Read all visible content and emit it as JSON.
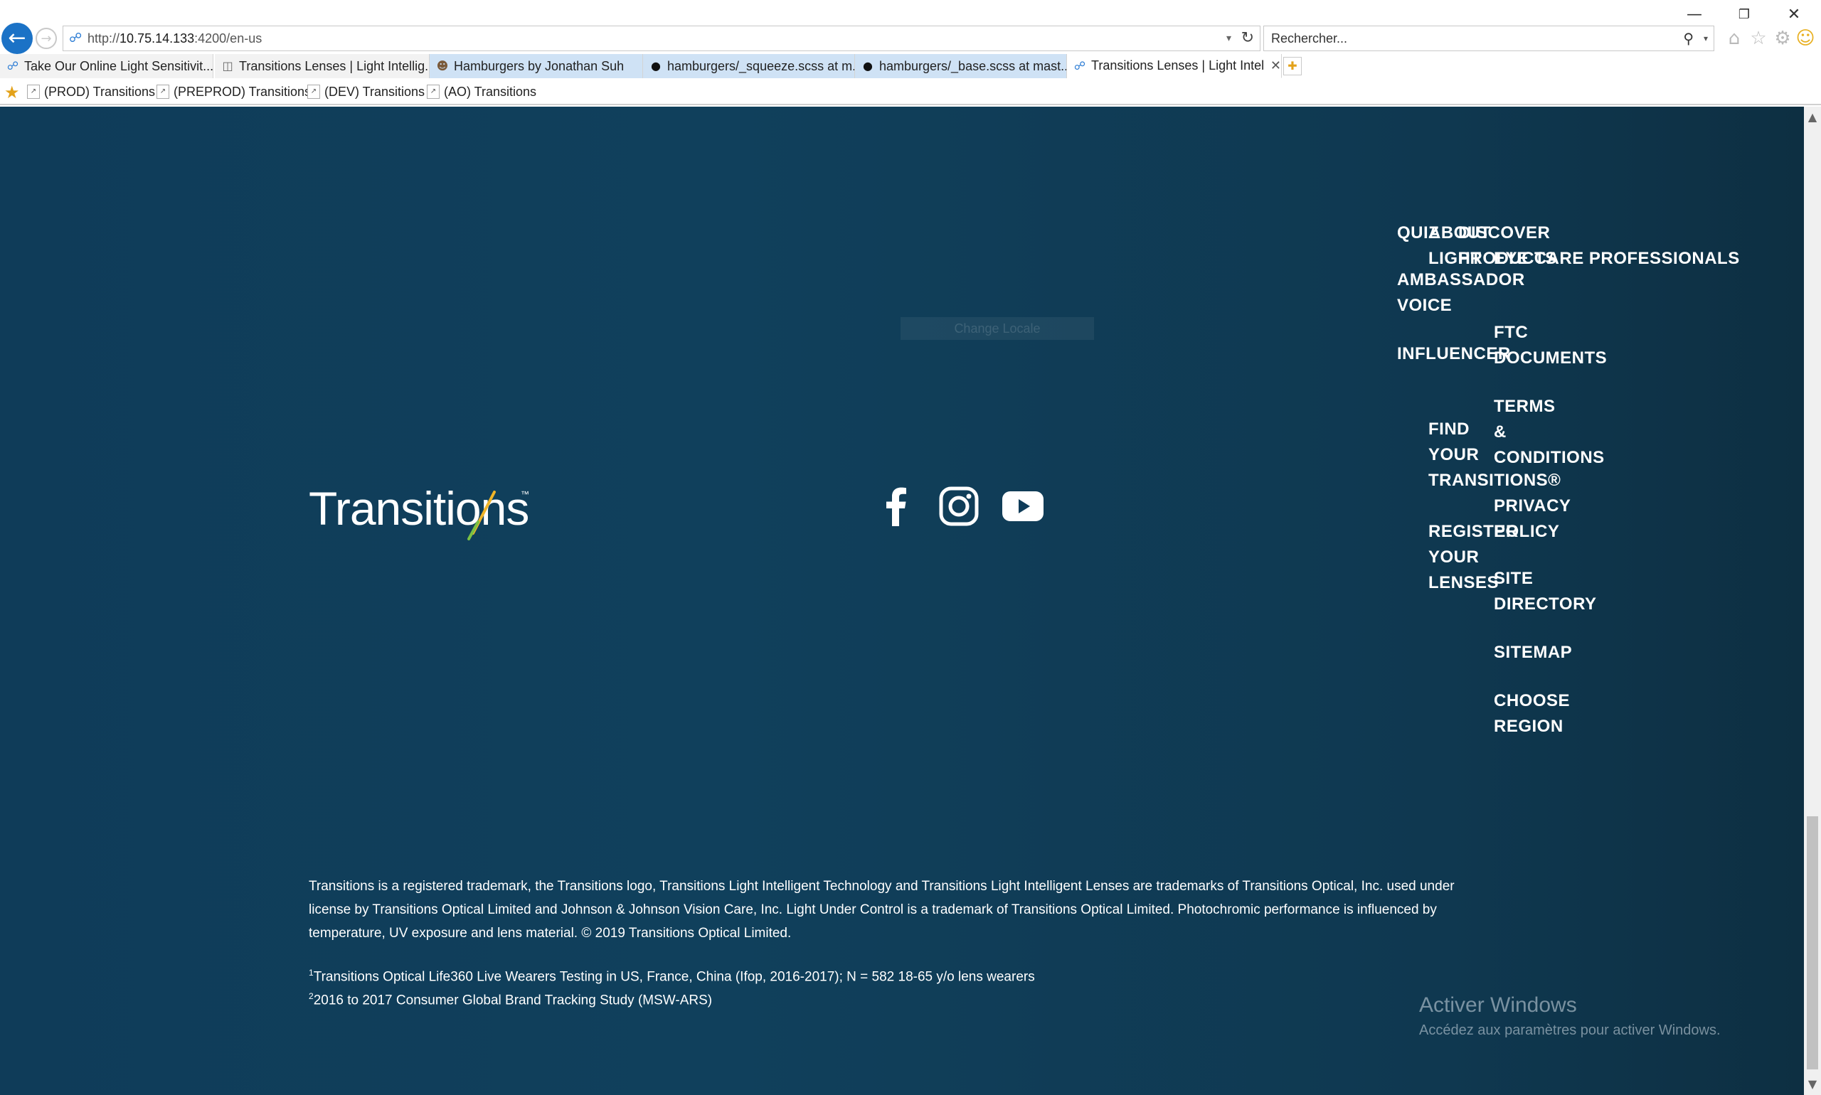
{
  "browser": {
    "back_label": "←",
    "forward_label": "→",
    "url_prefix": "http://",
    "url_host": "10.75.14.133",
    "url_path": ":4200/en-us",
    "search_placeholder": "Rechercher...",
    "window": {
      "minimize": "—",
      "restore": "❐",
      "close": "✕"
    }
  },
  "tabs": [
    {
      "label": "Take Our Online Light Sensitivit...",
      "icon": "ie-page-icon"
    },
    {
      "label": "Transitions Lenses | Light Intellig...",
      "icon": "page-icon"
    },
    {
      "label": "Hamburgers by Jonathan Suh",
      "icon": "avatar-icon"
    },
    {
      "label": "hamburgers/_squeeze.scss at m...",
      "icon": "github-icon"
    },
    {
      "label": "hamburgers/_base.scss at mast...",
      "icon": "github-icon"
    },
    {
      "label": "Transitions Lenses | Light Intel...",
      "icon": "ie-page-icon",
      "active": true
    }
  ],
  "favorites": [
    {
      "label": "(PROD) Transitions"
    },
    {
      "label": "(PREPROD) Transitions"
    },
    {
      "label": "(DEV) Transitions"
    },
    {
      "label": "(AO) Transitions"
    }
  ],
  "footer": {
    "logo_text": "Transitions",
    "ghost_button": "Change Locale",
    "nav_col1": {
      "quiz": "QUIZ",
      "ambassador": "AMBASSADOR\nVOICE",
      "influencer": "INFLUENCER"
    },
    "nav_col2": {
      "about": "ABOUT\nLIGHT",
      "find": "FIND\nYOUR\nTRANSITIONS®",
      "register": "REGISTER\nYOUR\nLENSES"
    },
    "nav_col3": {
      "discover": "DISCOVER\nPRODUCTS",
      "eye_care": "EYE CARE PROFESSIONALS",
      "ftc": "FTC\nDOCUMENTS",
      "terms": "TERMS\n&\nCONDITIONS",
      "privacy": "PRIVACY\nPOLICY",
      "site_directory": "SITE\nDIRECTORY",
      "sitemap": "SITEMAP",
      "choose_region": "CHOOSE\nREGION"
    },
    "legal": "Transitions is a registered trademark, the Transitions logo, Transitions Light Intelligent Technology and Transitions Light Intelligent Lenses are trademarks of Transitions Optical, Inc. used under license by Transitions Optical Limited and Johnson & Johnson Vision Care, Inc. Light Under Control is a trademark of Transitions Optical Limited. Photochromic performance is influenced by temperature, UV exposure and lens material. © 2019 Transitions Optical Limited.",
    "footnote1_sup": "1",
    "footnote1": "Transitions Optical Life360 Live Wearers Testing in US, France, China (Ifop, 2016-2017); N = 582 18-65 y/o lens wearers",
    "footnote2_sup": "2",
    "footnote2": "2016 to 2017 Consumer Global Brand Tracking Study (MSW-ARS)"
  },
  "windows_watermark": {
    "title": "Activer Windows",
    "subtitle": "Accédez aux paramètres pour activer Windows."
  }
}
